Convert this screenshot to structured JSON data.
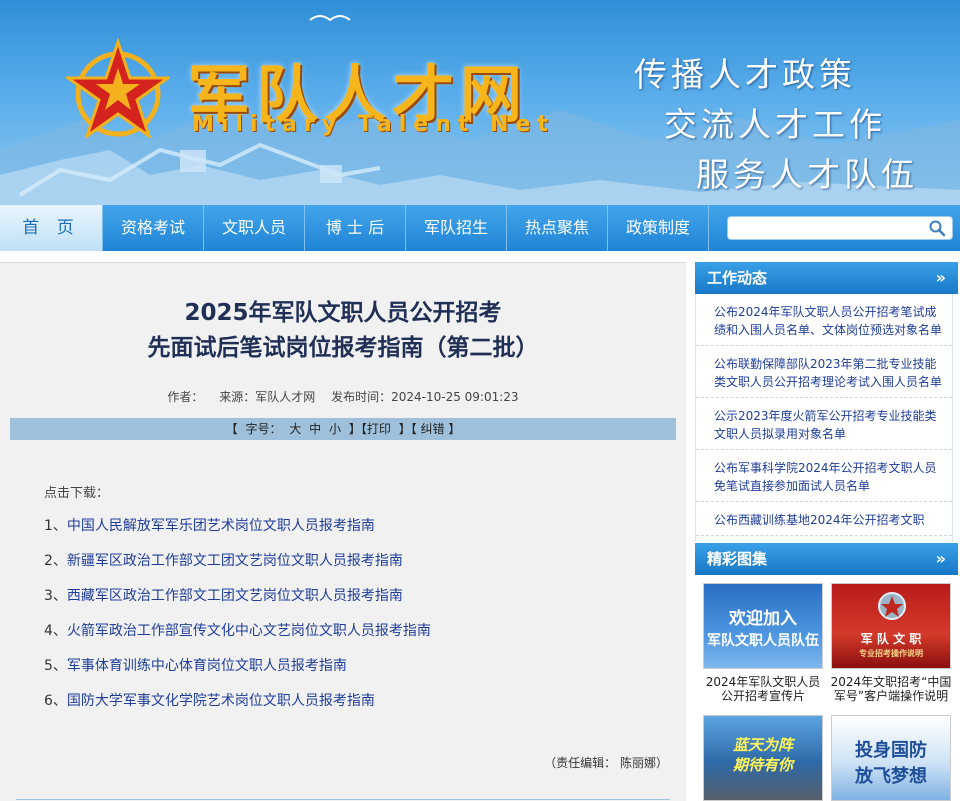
{
  "site": {
    "title_cn": "军队人才网",
    "title_en": "Military Talent Net",
    "slogans": [
      "传播人才政策",
      "交流人才工作",
      "服务人才队伍"
    ]
  },
  "nav": {
    "items": [
      "首 页",
      "资格考试",
      "文职人员",
      "博 士 后",
      "军队招生",
      "热点聚焦",
      "政策制度"
    ],
    "search_placeholder": ""
  },
  "article": {
    "title_line1": "2025年军队文职人员公开招考",
    "title_line2": "先面试后笔试岗位报考指南（第二批）",
    "author_label": "作者：",
    "source": "来源：军队人才网",
    "publish_time": "发布时间：2024-10-25 09:01:23",
    "font_bar": {
      "open": "【",
      "label": "字号：",
      "big": "大",
      "mid": "中",
      "small": "小",
      "print": "】【打印",
      "error": "】【 纠错 】"
    },
    "intro": "点击下载：",
    "documents": [
      {
        "num": "1、",
        "text": "中国人民解放军军乐团艺术岗位文职人员报考指南"
      },
      {
        "num": "2、",
        "text": "新疆军区政治工作部文工团文艺岗位文职人员报考指南"
      },
      {
        "num": "3、",
        "text": "西藏军区政治工作部文工团文艺岗位文职人员报考指南"
      },
      {
        "num": "4、",
        "text": "火箭军政治工作部宣传文化中心文艺岗位文职人员报考指南"
      },
      {
        "num": "5、",
        "text": "军事体育训练中心体育岗位文职人员报考指南"
      },
      {
        "num": "6、",
        "text": "国防大学军事文化学院艺术岗位文职人员报考指南"
      }
    ],
    "editor": "（责任编辑：   陈丽娜）"
  },
  "sidebar": {
    "news_title": "工作动态",
    "gallery_title": "精彩图集",
    "more": "»",
    "news": [
      "公布2024年军队文职人员公开招考笔试成绩和入围人员名单、文体岗位预选对象名单",
      "公布联勤保障部队2023年第二批专业技能类文职人员公开招考理论考试入围人员名单",
      "公示2023年度火箭军公开招考专业技能类文职人员拟录用对象名单",
      "公布军事科学院2024年公开招考文职人员免笔试直接参加面试人员名单",
      "公布西藏训练基地2024年公开招考文职"
    ],
    "gallery": [
      {
        "caption": "2024年军队文职人员公开招考宣传片",
        "img_text": [
          "欢迎加入",
          "军队文职人员队伍"
        ]
      },
      {
        "caption": "2024年文职招考“中国军号”客户端操作说明",
        "img_text": [
          "军 队 文 职",
          "专业招考操作说明"
        ]
      },
      {
        "caption": "",
        "img_text": [
          "蓝天为阵",
          "期待有你"
        ]
      },
      {
        "caption": "",
        "img_text": [
          "投身国防",
          "放飞梦想"
        ]
      }
    ]
  },
  "colors": {
    "nav_blue": "#1f84d6",
    "title_gold": "#f7b51c",
    "link_blue": "#1f3e9a",
    "side_head": "#1878c8"
  }
}
